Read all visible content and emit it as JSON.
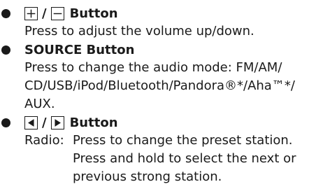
{
  "items": [
    {
      "symbol_left": "plus-box-icon",
      "separator": "/",
      "symbol_right": "minus-box-icon",
      "title": "Button",
      "lines": [
        "Press to adjust the volume up/down."
      ]
    },
    {
      "title": "SOURCE Button",
      "lines": [
        "Press to change the audio mode: FM/AM/",
        "CD/USB/iPod/Bluetooth/Pandora®*/Aha™*/",
        "AUX."
      ]
    },
    {
      "symbol_left": "left-triangle-box-icon",
      "separator": "/",
      "symbol_right": "right-triangle-box-icon",
      "title": "Button",
      "radio_label": "Radio:",
      "lines": [
        "Press to change the preset station.",
        "Press and hold to select the next or",
        "previous strong station."
      ]
    }
  ]
}
